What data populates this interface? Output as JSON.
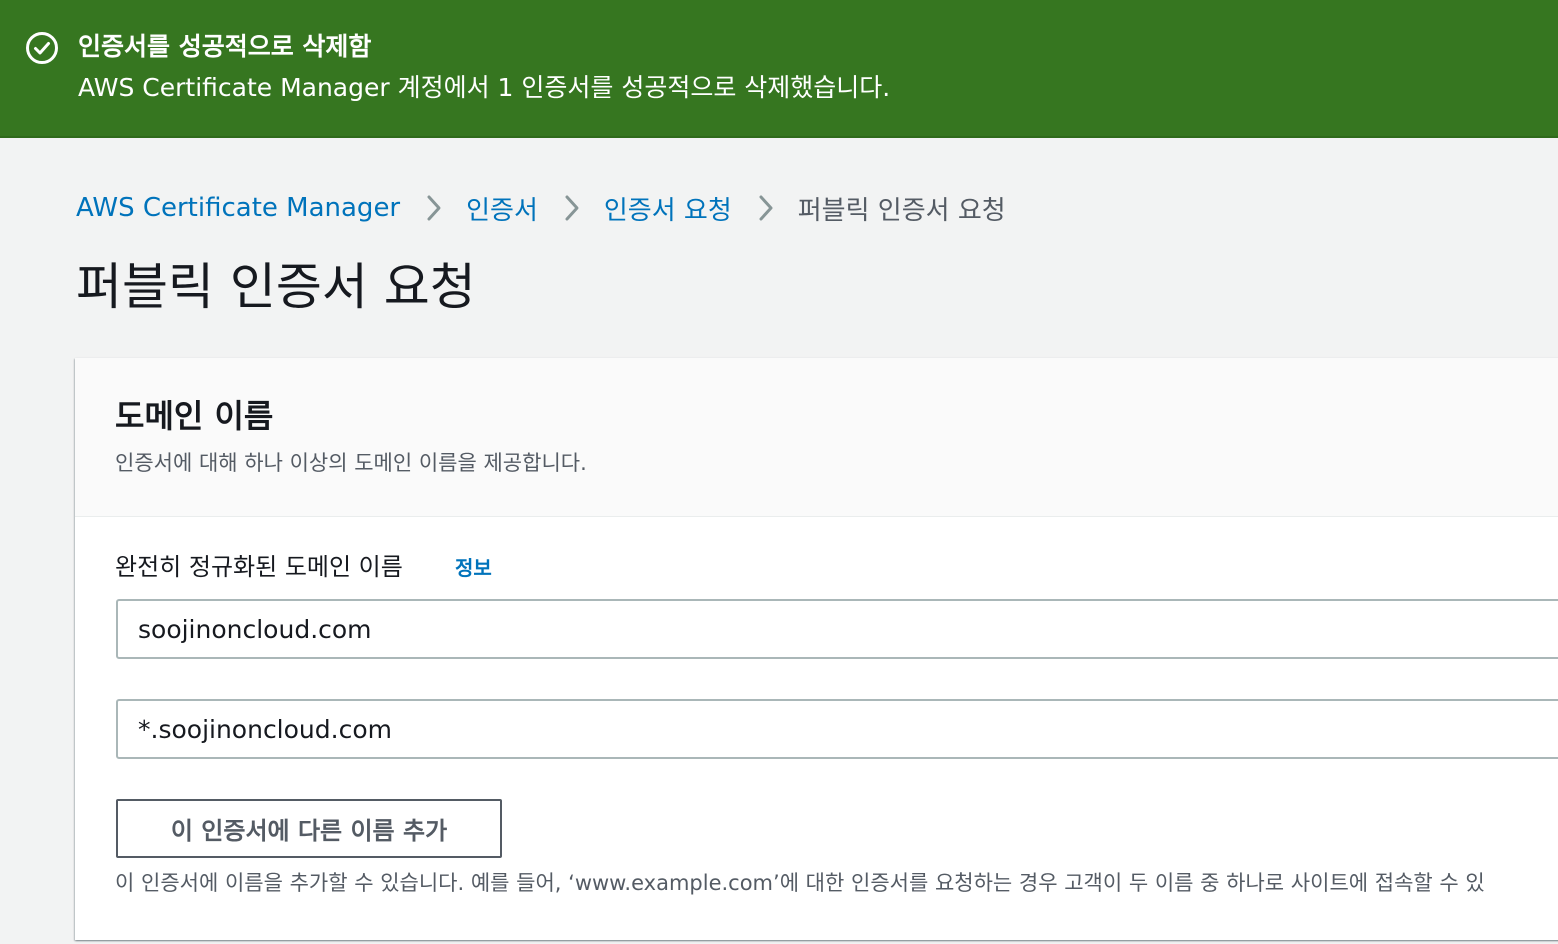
{
  "flash": {
    "title": "인증서를 성공적으로 삭제함",
    "message": "AWS Certificate Manager 계정에서 1 인증서를 성공적으로 삭제했습니다.",
    "icon": "check-circle-icon",
    "color": "#367620"
  },
  "breadcrumb": {
    "items": [
      "AWS Certificate Manager",
      "인증서",
      "인증서 요청",
      "퍼블릭 인증서 요청"
    ]
  },
  "page": {
    "title": "퍼블릭 인증서 요청"
  },
  "domain_section": {
    "title": "도메인 이름",
    "description": "인증서에 대해 하나 이상의 도메인 이름을 제공합니다.",
    "field_label": "완전히 정규화된 도메인 이름",
    "info_label": "정보",
    "inputs": [
      "soojinoncloud.com",
      "*.soojinoncloud.com"
    ],
    "add_button_label": "이 인증서에 다른 이름 추가",
    "help_text": "이 인증서에 이름을 추가할 수 있습니다. 예를 들어, ‘www.example.com’에 대한 인증서를 요청하는 경우 고객이 두 이름 중 하나로 사이트에 접속할 수 있"
  },
  "colors": {
    "link": "#0073bb",
    "success": "#367620",
    "background": "#f2f3f3"
  }
}
